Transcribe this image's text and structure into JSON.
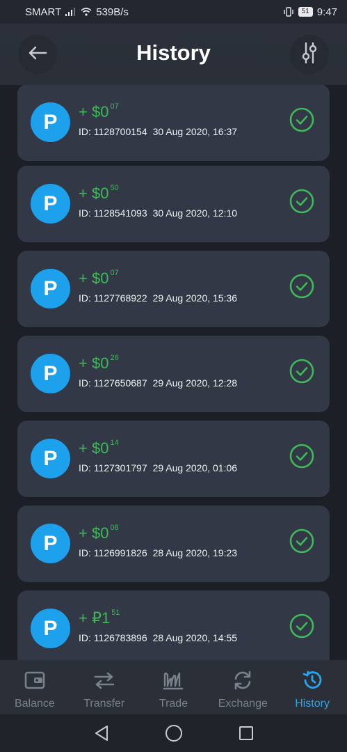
{
  "status_bar": {
    "carrier": "SMART",
    "speed": "539B/s",
    "battery": "51",
    "time": "9:47"
  },
  "header": {
    "title": "History"
  },
  "transactions": [
    {
      "sign": "+",
      "amount_main": "$0",
      "amount_cents": "07",
      "id": "ID: 1128700154",
      "date": "30 Aug 2020, 16:37"
    },
    {
      "sign": "+",
      "amount_main": "$0",
      "amount_cents": "50",
      "id": "ID: 1128541093",
      "date": "30 Aug 2020, 12:10"
    },
    {
      "sign": "+",
      "amount_main": "$0",
      "amount_cents": "07",
      "id": "ID: 1127768922",
      "date": "29 Aug 2020, 15:36"
    },
    {
      "sign": "+",
      "amount_main": "$0",
      "amount_cents": "26",
      "id": "ID: 1127650687",
      "date": "29 Aug 2020, 12:28"
    },
    {
      "sign": "+",
      "amount_main": "$0",
      "amount_cents": "14",
      "id": "ID: 1127301797",
      "date": "29 Aug 2020, 01:06"
    },
    {
      "sign": "+",
      "amount_main": "$0",
      "amount_cents": "08",
      "id": "ID: 1126991826",
      "date": "28 Aug 2020, 19:23"
    },
    {
      "sign": "+",
      "amount_main": "₽1",
      "amount_cents": "51",
      "id": "ID: 1126783896",
      "date": "28 Aug 2020, 14:55"
    }
  ],
  "avatar_letter": "P",
  "bottom_nav": [
    {
      "label": "Balance",
      "icon": "wallet-icon",
      "active": false
    },
    {
      "label": "Transfer",
      "icon": "transfer-arrows-icon",
      "active": false
    },
    {
      "label": "Trade",
      "icon": "trade-chart-icon",
      "active": false
    },
    {
      "label": "Exchange",
      "icon": "exchange-refresh-icon",
      "active": false
    },
    {
      "label": "History",
      "icon": "history-clock-icon",
      "active": true
    }
  ],
  "colors": {
    "background": "#1c1f26",
    "card": "#323845",
    "positive": "#3fb95a",
    "accent": "#2aa6ee",
    "avatar": "#1ea1ec"
  }
}
